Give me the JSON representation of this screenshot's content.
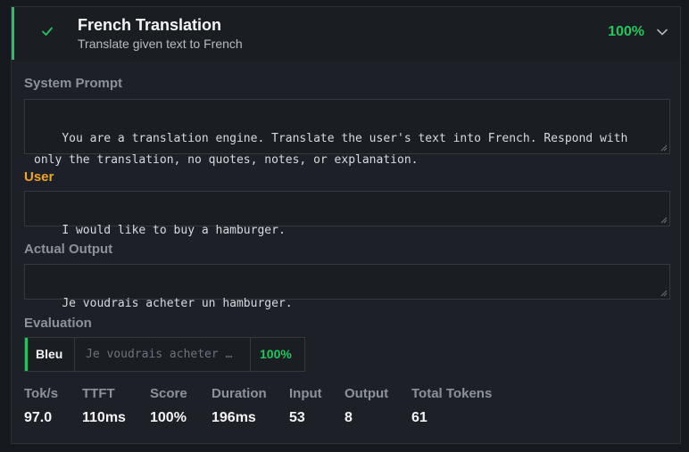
{
  "header": {
    "title": "French Translation",
    "subtitle": "Translate given text to French",
    "percent": "100%",
    "accent": "#22c55e"
  },
  "system_prompt": {
    "label": "System Prompt",
    "value": "You are a translation engine. Translate the user's text into French. Respond with only the translation, no quotes, notes, or explanation."
  },
  "user": {
    "label": "User",
    "value": "I would like to buy a hamburger.",
    "color": "#f0a526"
  },
  "actual_output": {
    "label": "Actual Output",
    "value": "Je voudrais acheter un hamburger."
  },
  "evaluation": {
    "label": "Evaluation",
    "metric": "Bleu",
    "preview": "Je voudrais acheter …",
    "score": "100%"
  },
  "stats": [
    {
      "label": "Tok/s",
      "value": "97.0"
    },
    {
      "label": "TTFT",
      "value": "110ms"
    },
    {
      "label": "Score",
      "value": "100%"
    },
    {
      "label": "Duration",
      "value": "196ms"
    },
    {
      "label": "Input",
      "value": "53"
    },
    {
      "label": "Output",
      "value": "8"
    },
    {
      "label": "Total Tokens",
      "value": "61"
    }
  ]
}
